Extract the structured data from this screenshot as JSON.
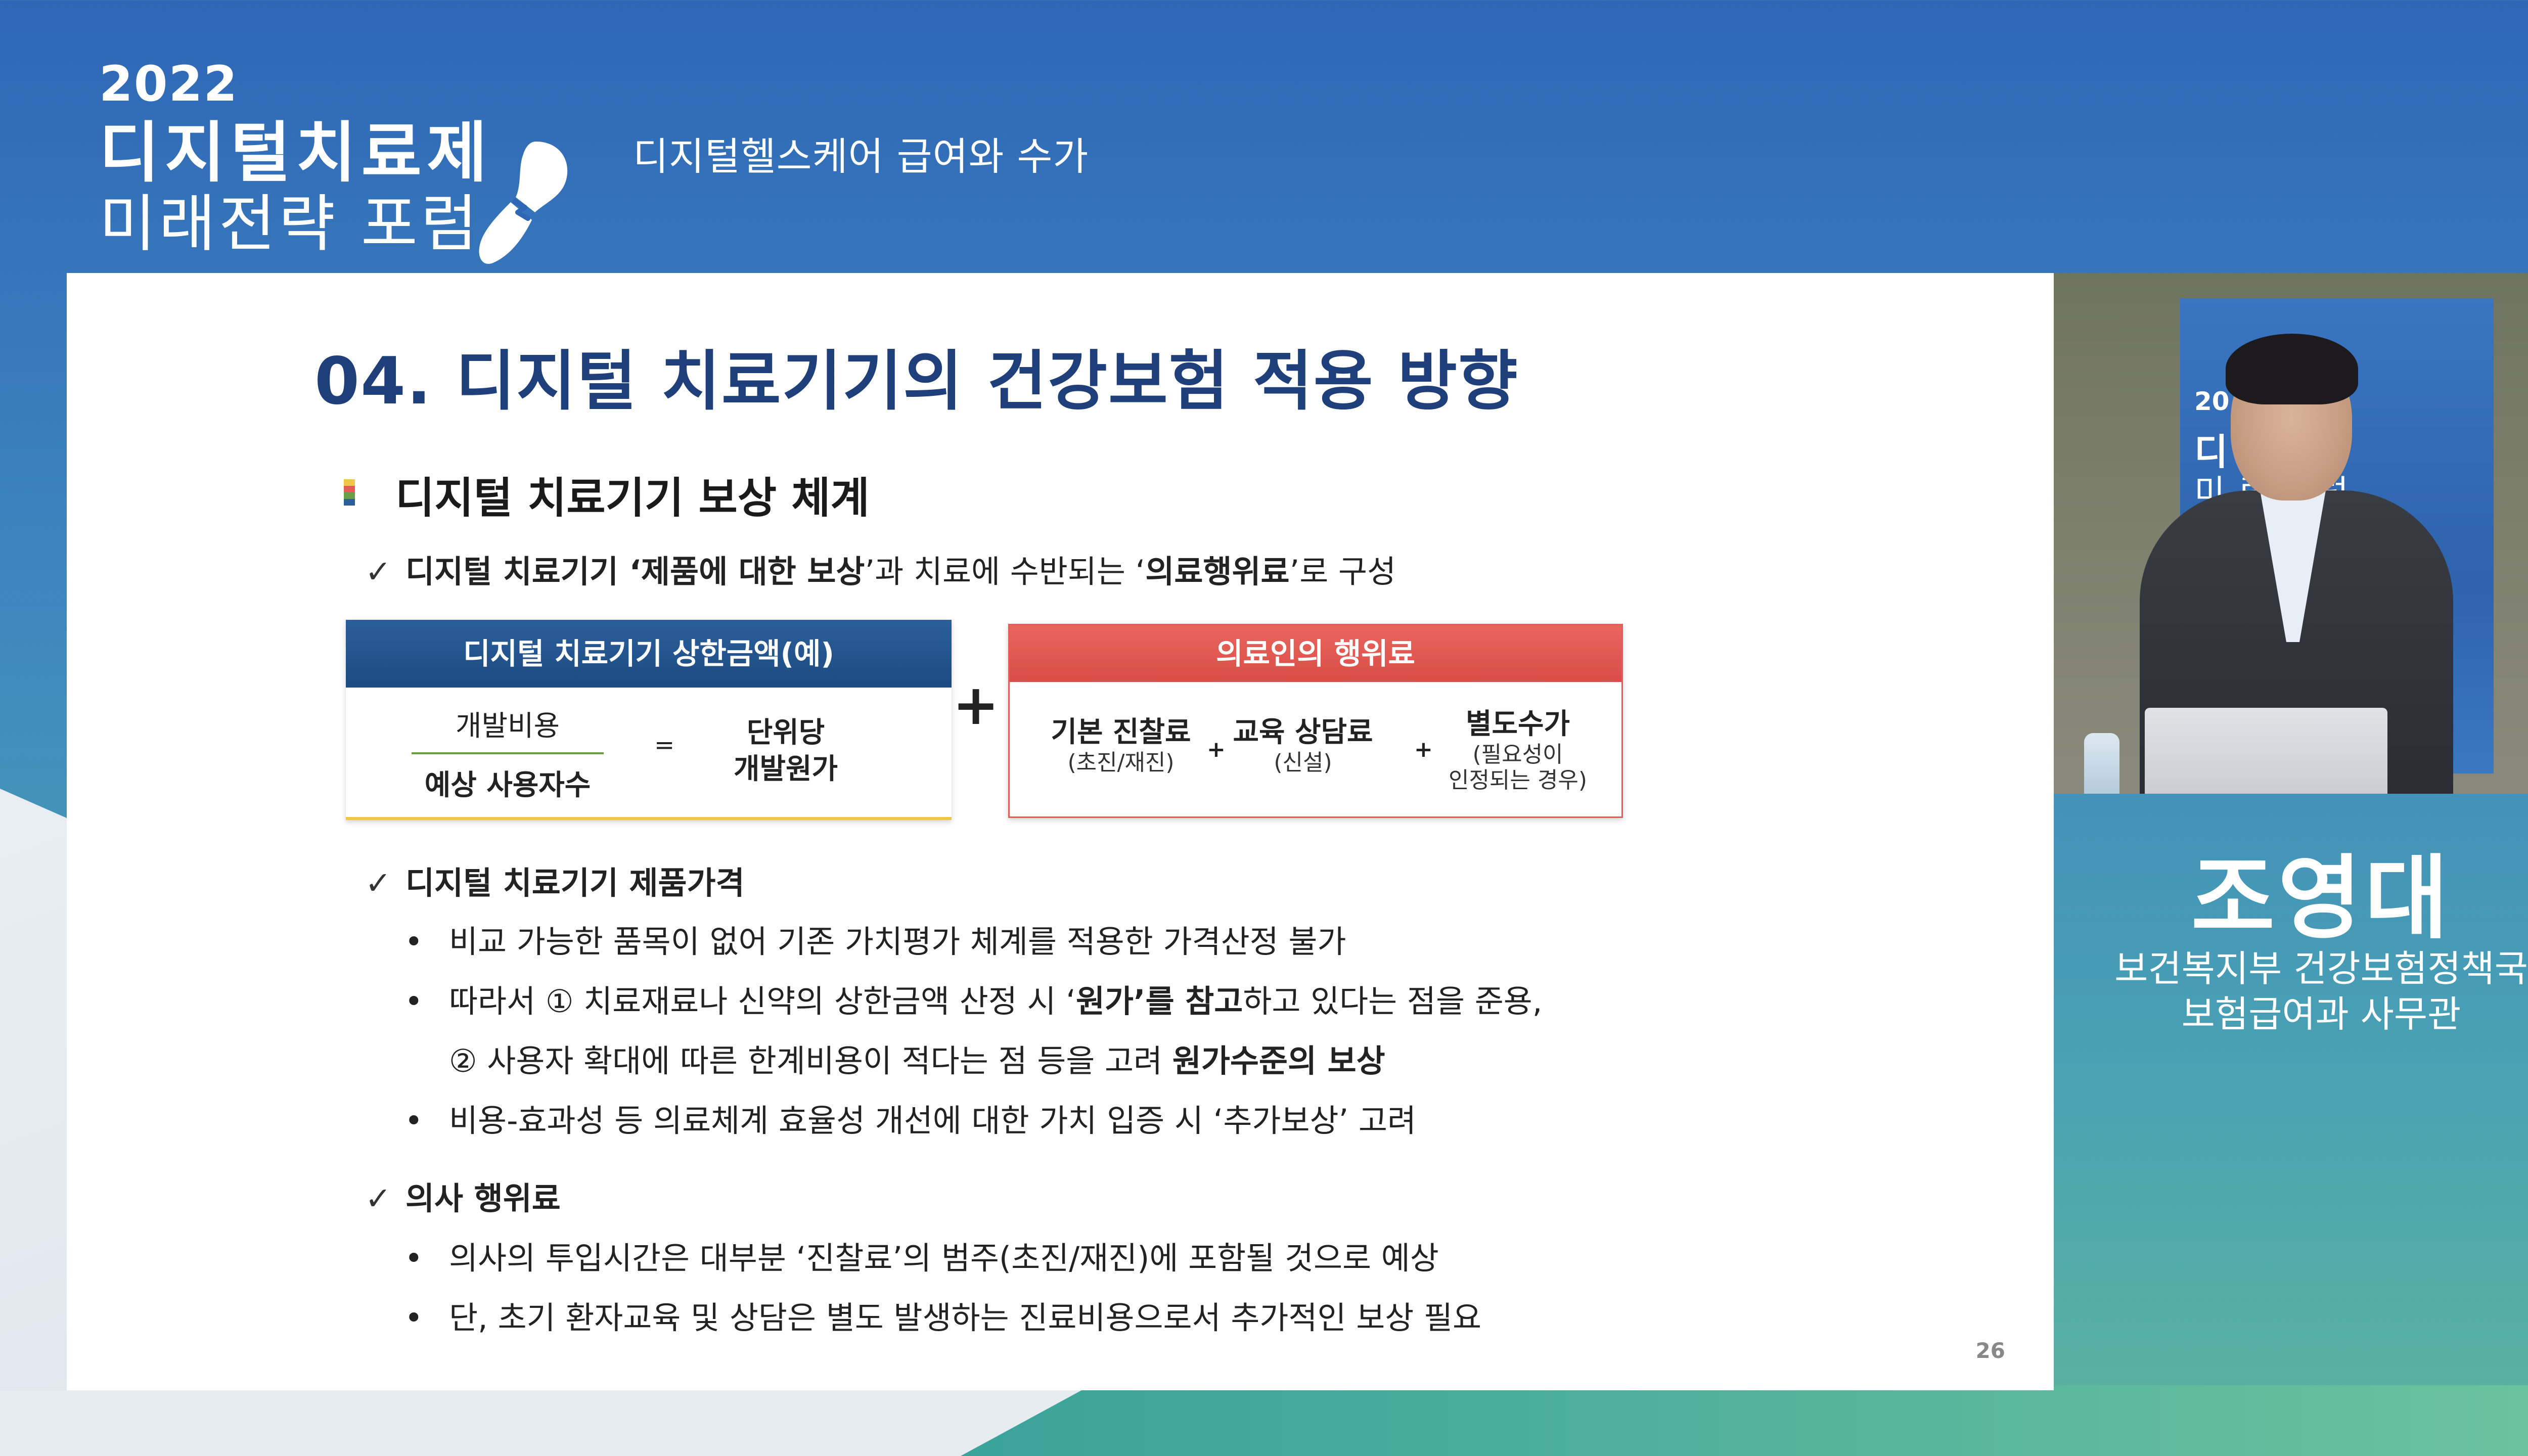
{
  "header": {
    "brand_year": "2022",
    "brand_line1": "디지털치료제",
    "brand_line2": "미래전략 포럼",
    "subtitle": "디지털헬스케어 급여와 수가"
  },
  "slide": {
    "title": "04. 디지털 치료기기의 건강보험 적용 방향",
    "section_heading": "디지털 치료기기 보상 체계",
    "check_mark": "✓",
    "bullet_mark": "•",
    "check1": {
      "t1": "디지털 치료기기 ‘",
      "t2": "제품에 대한 보상",
      "t3": "’과 치료에 수반되는 ‘",
      "t4": "의료행위료",
      "t5": "’로 구성"
    },
    "box_left": {
      "header": "디지털 치료기기 상한금액(예)",
      "numerator": "개발비용",
      "denominator": "예상 사용자수",
      "equals": "=",
      "result_line1": "단위당",
      "result_line2": "개발원가"
    },
    "plus": "+",
    "box_right": {
      "header": "의료인의 행위료",
      "fee1_main": "기본 진찰료",
      "fee1_sub": "(초진/재진)",
      "fee2_main": "교육 상담료",
      "fee2_sub": "(신설)",
      "fee3_main": "별도수가",
      "fee3_sub1": "(필요성이",
      "fee3_sub2": "인정되는 경우)",
      "plus_small": "+"
    },
    "check2": "디지털 치료기기 제품가격",
    "bullet1": "비교 가능한 품목이 없어 기존 가치평가 체계를 적용한 가격산정 불가",
    "bullet2": {
      "t1": "따라서 ① 치료재료나 신약의 상한금액 산정 시 ‘",
      "t2": "원가’를 참고",
      "t3": "하고 있다는 점을 준용,"
    },
    "bullet2b": {
      "t1": "② 사용자 확대에 따른 한계비용이 적다는 점 등을 고려 ",
      "t2": "원가수준의 보상"
    },
    "bullet3": "비용-효과성 등 의료체계 효율성 개선에 대한 가치 입증 시 ‘추가보상’ 고려",
    "check3": "의사 행위료",
    "bullet4": "의사의 투입시간은 대부분 ‘진찰료’의 범주(초진/재진)에 포함될 것으로 예상",
    "bullet5": "단, 초기 환자교육 및 상담은 별도 발생하는 진료비용으로서 추가적인 보상 필요",
    "page_number": "26"
  },
  "video": {
    "banner_year": "20",
    "banner_line1": "디  료제",
    "banner_line2": "미  략 포럼"
  },
  "speaker": {
    "name": "조영대",
    "org": "보건복지부 건강보험정책국",
    "role": "보험급여과 사무관"
  },
  "colors": {
    "title_blue": "#1e3f7a",
    "left_box_header": "#1d4a80",
    "right_box_header": "#d94d47",
    "underline_yellow": "#f0c64a",
    "formula_bar_green": "#6a9f4a"
  },
  "icons": {
    "brand_logo": "capsule-heart-logo-icon",
    "section_marker": "color-bar-marker-icon"
  }
}
